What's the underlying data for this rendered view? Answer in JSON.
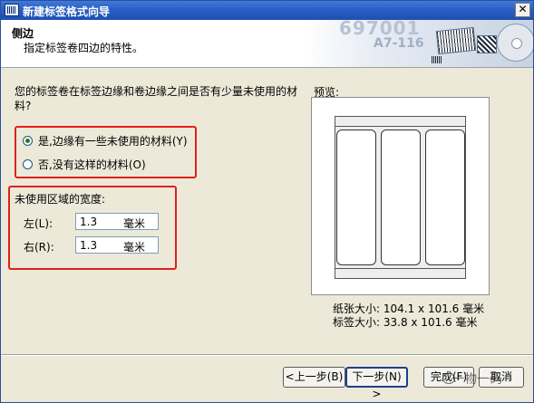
{
  "window": {
    "title": "新建标签格式向导",
    "close_glyph": "✕"
  },
  "header": {
    "title": "侧边",
    "subtitle": "指定标签卷四边的特性。",
    "art": {
      "num1": "697001",
      "num2": "A7-116"
    }
  },
  "question": "您的标签卷在标签边缘和卷边缘之间是否有少量未使用的材料?",
  "options": [
    {
      "label": "是,边缘有一些未使用的材料(Y)",
      "checked": true
    },
    {
      "label": "否,没有这样的材料(O)",
      "checked": false
    }
  ],
  "unused_width": {
    "label": "未使用区域的宽度:",
    "left": {
      "label": "左(L):",
      "value": "1.3",
      "unit": "毫米"
    },
    "right": {
      "label": "右(R):",
      "value": "1.3",
      "unit": "毫米"
    }
  },
  "preview": {
    "label": "预览:",
    "label_columns": 3,
    "paper_size": "纸张大小: 104.1 x 101.6 毫米",
    "label_size": "标签大小: 33.8 x 101.6 毫米"
  },
  "buttons": {
    "back": "<上一步(B)",
    "next": "下一步(N) >",
    "finish": "完成(F)",
    "cancel": "取消"
  },
  "watermark": "一物一码",
  "colors": {
    "highlight": "#e0211b",
    "titlebar": "#2a5fc5"
  }
}
